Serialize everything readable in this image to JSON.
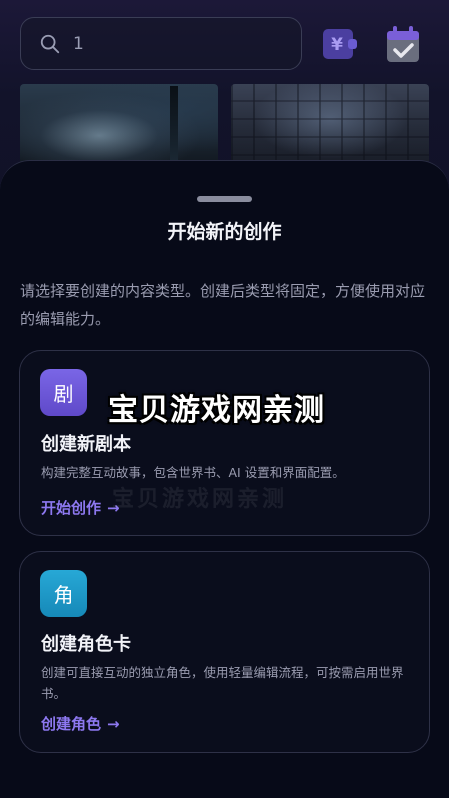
{
  "search": {
    "value": "1"
  },
  "sheet": {
    "title": "开始新的创作",
    "description": "请选择要创建的内容类型。创建后类型将固定，方便使用对应的编辑能力。"
  },
  "cards": [
    {
      "icon_char": "剧",
      "icon_color": "#6b55d8",
      "title": "创建新剧本",
      "description": "构建完整互动故事，包含世界书、AI 设置和界面配置。",
      "link": "开始创作",
      "arrow": "→"
    },
    {
      "icon_char": "角",
      "icon_color": "#1d97c6",
      "title": "创建角色卡",
      "description": "创建可直接互动的独立角色，使用轻量编辑流程，可按需启用世界书。",
      "link": "创建角色",
      "arrow": "→"
    }
  ],
  "watermark": "宝贝游戏网亲测",
  "icons": {
    "search": "search-icon",
    "currency": "yen-wallet-icon",
    "checkin": "calendar-check-icon"
  },
  "colors": {
    "accent": "#8d78f0",
    "background": "#070a18"
  }
}
